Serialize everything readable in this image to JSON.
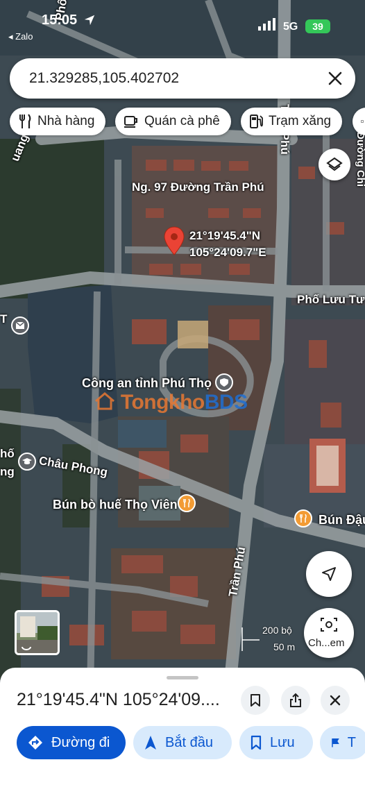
{
  "status_bar": {
    "time": "15:05",
    "back_app": "◂ Zalo",
    "network": "5G",
    "battery": "39"
  },
  "search": {
    "query": "21.329285,105.402702"
  },
  "chips": [
    {
      "label": "Nhà hàng",
      "icon": "fork-knife-icon"
    },
    {
      "label": "Quán cà phê",
      "icon": "coffee-cup-icon"
    },
    {
      "label": "Trạm xăng",
      "icon": "gas-pump-icon"
    }
  ],
  "map": {
    "pin_coords_line1": "21°19'45.4\"N",
    "pin_coords_line2": "105°24'09.7\"E",
    "labels": {
      "street_ng97": "Ng. 97 Đường Trần Phú",
      "street_tran_phu_top": "Trần Phú",
      "street_tran_phu_bottom": "Trần Phú",
      "street_pho_luu_tu": "Phố Lưu Tư",
      "street_chau_phong": "Châu Phong",
      "street_quang": "uang",
      "street_pho_top": "Phố",
      "street_duong_right": "Đường Chi",
      "street_ho_left": "hố",
      "street_ng_left": "ng",
      "poi_police": "Công an tỉnh Phú Thọ",
      "poi_bun_bo": "Bún bò huế Thọ Viên",
      "poi_bun_dau": "Bún Đậu",
      "left_t": "T"
    },
    "watermark_main": "Tongkho",
    "watermark_accent": "BDS",
    "scale_feet": "200 bộ",
    "scale_meters": "50 m",
    "screenshot_label": "Ch...em"
  },
  "sheet": {
    "title": "21°19'45.4\"N 105°24'09....",
    "actions": [
      {
        "label": "Đường đi",
        "icon": "directions-icon"
      },
      {
        "label": "Bắt đầu",
        "icon": "navigation-arrow-icon"
      },
      {
        "label": "Lưu",
        "icon": "bookmark-icon"
      },
      {
        "label": "T",
        "icon": "flag-icon"
      }
    ]
  },
  "colors": {
    "accent": "#0b57d0",
    "accent_light": "#d8eafc",
    "pin": "#ea4335",
    "poi_food": "#f29b34",
    "poi_grey": "#5f6368"
  }
}
